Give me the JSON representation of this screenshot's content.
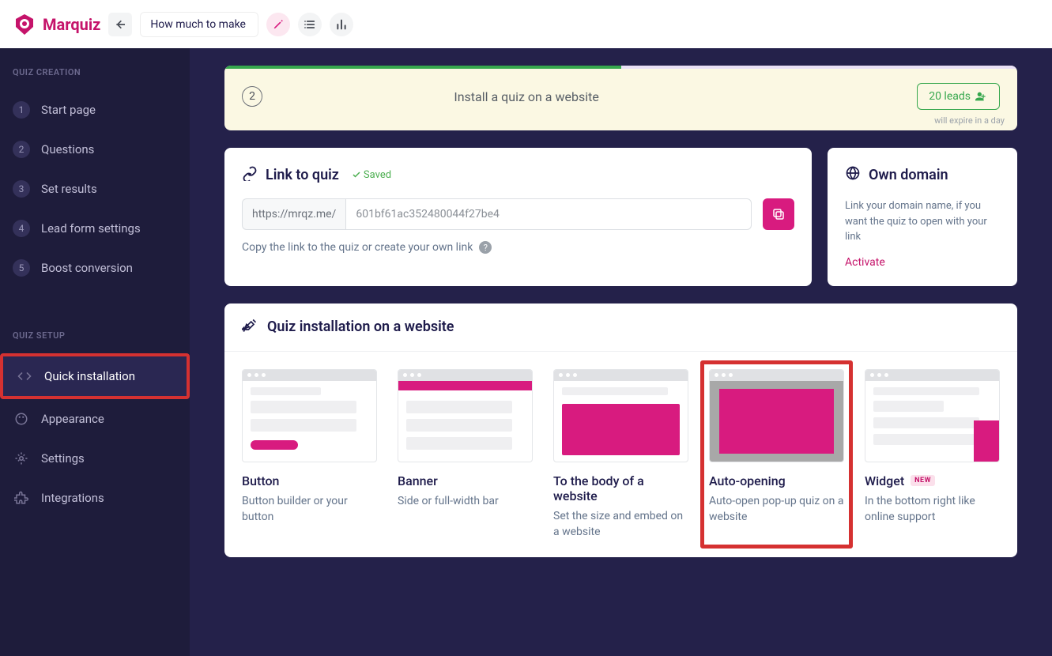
{
  "brand": {
    "name": "Marquiz"
  },
  "header": {
    "quiz_title": "How much to make a"
  },
  "sidebar": {
    "sections": [
      {
        "title": "QUIZ CREATION",
        "items": [
          {
            "num": "1",
            "label": "Start page"
          },
          {
            "num": "2",
            "label": "Questions"
          },
          {
            "num": "3",
            "label": "Set results"
          },
          {
            "num": "4",
            "label": "Lead form settings"
          },
          {
            "num": "5",
            "label": "Boost conversion"
          }
        ]
      },
      {
        "title": "QUIZ SETUP",
        "items": [
          {
            "icon": "code",
            "label": "Quick installation",
            "active": true
          },
          {
            "icon": "appearance",
            "label": "Appearance"
          },
          {
            "icon": "settings",
            "label": "Settings"
          },
          {
            "icon": "integrations",
            "label": "Integrations"
          }
        ]
      }
    ]
  },
  "banner": {
    "step": "2",
    "text": "Install a quiz on a website",
    "button": "20 leads",
    "note": "will expire in a day"
  },
  "link_card": {
    "title": "Link to quiz",
    "saved": "Saved",
    "prefix": "https://mrqz.me/",
    "value": "601bf61ac352480044f27be4",
    "help": "Copy the link to the quiz or create your own link"
  },
  "domain_card": {
    "title": "Own domain",
    "desc": "Link your domain name, if you want the quiz to open with your link",
    "activate": "Activate"
  },
  "install": {
    "title": "Quiz installation on a website",
    "items": [
      {
        "title": "Button",
        "desc": "Button builder or your button"
      },
      {
        "title": "Banner",
        "desc": "Side or full-width bar"
      },
      {
        "title": "To the body of a website",
        "desc": "Set the size and embed on a website"
      },
      {
        "title": "Auto-opening",
        "desc": "Auto-open pop-up quiz on a website"
      },
      {
        "title": "Widget",
        "desc": "In the bottom right like online support",
        "badge": "NEW"
      }
    ]
  }
}
